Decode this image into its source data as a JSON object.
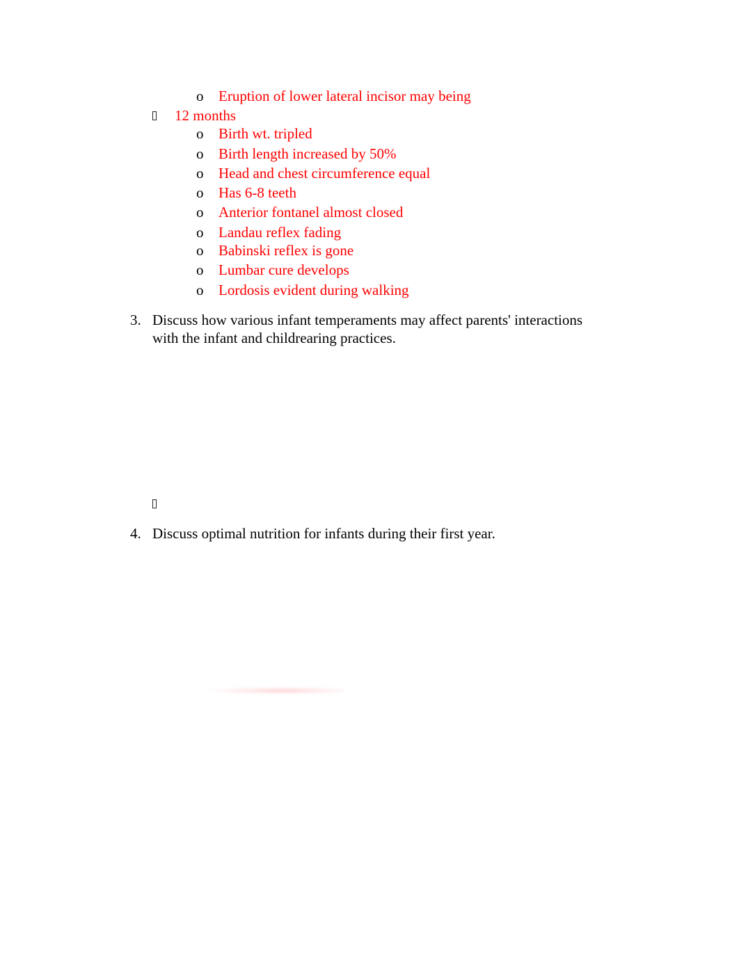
{
  "document": {
    "accent_color": "#ff0000",
    "prev_item": {
      "marker": "o",
      "text": "Eruption of lower lateral incisor may being"
    },
    "twelve_months": {
      "label": "12 months",
      "items": [
        {
          "marker": "o",
          "text": "Birth wt. tripled"
        },
        {
          "marker": "o",
          "text": "Birth length increased by 50%"
        },
        {
          "marker": "o",
          "text": "Head and chest circumference equal"
        },
        {
          "marker": "o",
          "text": "Has 6-8 teeth"
        },
        {
          "marker": "o",
          "text": "Anterior fontanel almost closed"
        },
        {
          "marker": "o",
          "text": "Landau reflex fading"
        },
        {
          "marker": "o",
          "text": "Babinski reflex is gone"
        },
        {
          "marker": "o",
          "text": "Lumbar cure develops"
        },
        {
          "marker": "o",
          "text": "Lordosis evident during walking"
        }
      ]
    },
    "questions": [
      {
        "number": "3.",
        "line1": "Discuss how various infant temperaments may affect parents' interactions",
        "line2": "with the infant and childrearing practices."
      },
      {
        "number": "4.",
        "line1": "Discuss optimal nutrition for infants during their first year."
      }
    ]
  }
}
